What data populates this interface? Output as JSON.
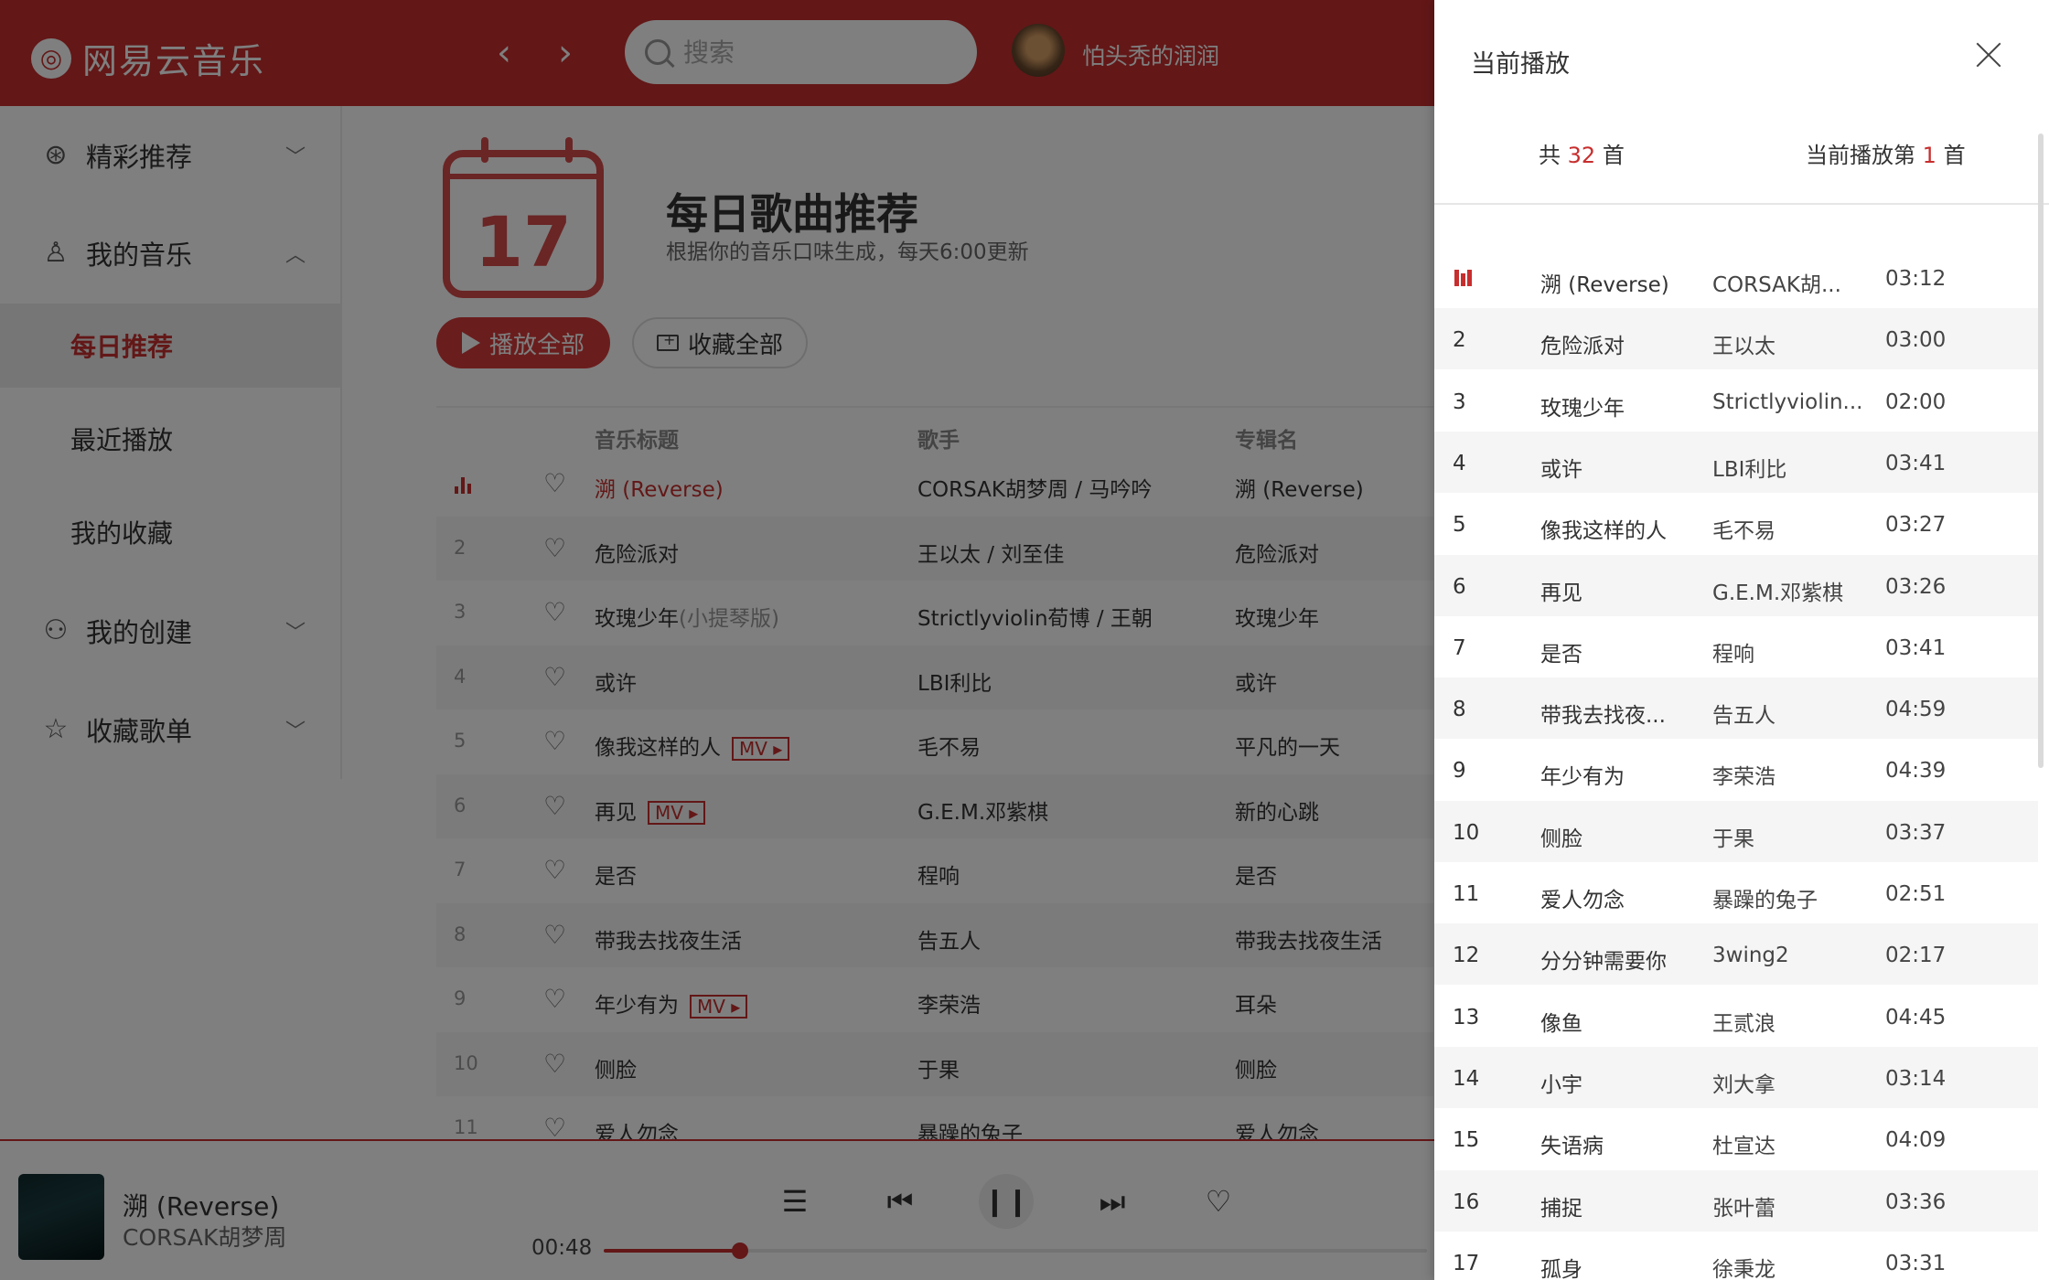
{
  "header": {
    "app_name": "网易云音乐",
    "back_icon": "‹",
    "forward_icon": "›",
    "search_placeholder": "搜索",
    "username": "怕头秃的润润"
  },
  "sidebar": {
    "groups": [
      {
        "label": "精彩推荐",
        "icon": "basketball-icon",
        "expanded": false
      },
      {
        "label": "我的音乐",
        "icon": "user-icon",
        "expanded": true
      },
      {
        "label": "我的创建",
        "icon": "bicycle-icon",
        "expanded": false
      },
      {
        "label": "收藏歌单",
        "icon": "star-icon",
        "expanded": false
      }
    ],
    "sub_items": [
      "每日推荐",
      "最近播放",
      "我的收藏"
    ],
    "active_item": "每日推荐"
  },
  "main": {
    "calendar_day": "17",
    "title": "每日歌曲推荐",
    "subtitle": "根据你的音乐口味生成，每天6:00更新",
    "play_all": "播放全部",
    "collect_all": "收藏全部",
    "columns": [
      "音乐标题",
      "歌手",
      "专辑名"
    ],
    "songs": [
      {
        "index": "1",
        "title": "溯 (Reverse)",
        "title_extra": "",
        "mv": false,
        "artist": "CORSAK胡梦周 / 马吟吟",
        "album": "溯 (Reverse)",
        "playing": true
      },
      {
        "index": "2",
        "title": "危险派对",
        "title_extra": "",
        "mv": false,
        "artist": "王以太 / 刘至佳",
        "album": "危险派对",
        "playing": false
      },
      {
        "index": "3",
        "title": "玫瑰少年",
        "title_extra": "(小提琴版)",
        "mv": false,
        "artist": "Strictlyviolin荀博 / 王朝",
        "album": "玫瑰少年",
        "playing": false
      },
      {
        "index": "4",
        "title": "或许",
        "title_extra": "",
        "mv": false,
        "artist": "LBI利比",
        "album": "或许",
        "playing": false
      },
      {
        "index": "5",
        "title": "像我这样的人",
        "title_extra": "",
        "mv": true,
        "artist": "毛不易",
        "album": "平凡的一天",
        "playing": false
      },
      {
        "index": "6",
        "title": "再见",
        "title_extra": "",
        "mv": true,
        "artist": "G.E.M.邓紫棋",
        "album": "新的心跳",
        "playing": false
      },
      {
        "index": "7",
        "title": "是否",
        "title_extra": "",
        "mv": false,
        "artist": "程响",
        "album": "是否",
        "playing": false
      },
      {
        "index": "8",
        "title": "带我去找夜生活",
        "title_extra": "",
        "mv": false,
        "artist": "告五人",
        "album": "带我去找夜生活",
        "playing": false
      },
      {
        "index": "9",
        "title": "年少有为",
        "title_extra": "",
        "mv": true,
        "artist": "李荣浩",
        "album": "耳朵",
        "playing": false
      },
      {
        "index": "10",
        "title": "侧脸",
        "title_extra": "",
        "mv": false,
        "artist": "于果",
        "album": "侧脸",
        "playing": false
      },
      {
        "index": "11",
        "title": "爱人勿念",
        "title_extra": "",
        "mv": false,
        "artist": "暴躁的兔子",
        "album": "爱人勿念",
        "playing": false
      }
    ],
    "mv_label": "MV ▸"
  },
  "player": {
    "song": "溯 (Reverse)",
    "artist": "CORSAK胡梦周",
    "current_time": "00:48",
    "progress_fraction": 0.165,
    "playlist_icon": "☰",
    "prev_icon": "⏮",
    "pause_icon": "❙❙",
    "next_icon": "⏭",
    "like_icon": "♡"
  },
  "panel": {
    "title": "当前播放",
    "total_prefix": "共",
    "total_count": "32",
    "total_suffix": "首",
    "current_prefix": "当前播放第",
    "current_index": "1",
    "current_suffix": "首",
    "tracks": [
      {
        "index": "1",
        "title": "溯 (Reverse)",
        "artist": "CORSAK胡...",
        "duration": "03:12",
        "playing": true
      },
      {
        "index": "2",
        "title": "危险派对",
        "artist": "王以太",
        "duration": "03:00",
        "playing": false
      },
      {
        "index": "3",
        "title": "玫瑰少年",
        "artist": "Strictlyviolin...",
        "duration": "02:00",
        "playing": false
      },
      {
        "index": "4",
        "title": "或许",
        "artist": "LBI利比",
        "duration": "03:41",
        "playing": false
      },
      {
        "index": "5",
        "title": "像我这样的人",
        "artist": "毛不易",
        "duration": "03:27",
        "playing": false
      },
      {
        "index": "6",
        "title": "再见",
        "artist": "G.E.M.邓紫棋",
        "duration": "03:26",
        "playing": false
      },
      {
        "index": "7",
        "title": "是否",
        "artist": "程响",
        "duration": "03:41",
        "playing": false
      },
      {
        "index": "8",
        "title": "带我去找夜...",
        "artist": "告五人",
        "duration": "04:59",
        "playing": false
      },
      {
        "index": "9",
        "title": "年少有为",
        "artist": "李荣浩",
        "duration": "04:39",
        "playing": false
      },
      {
        "index": "10",
        "title": "侧脸",
        "artist": "于果",
        "duration": "03:37",
        "playing": false
      },
      {
        "index": "11",
        "title": "爱人勿念",
        "artist": "暴躁的兔子",
        "duration": "02:51",
        "playing": false
      },
      {
        "index": "12",
        "title": "分分钟需要你",
        "artist": "3wing2",
        "duration": "02:17",
        "playing": false
      },
      {
        "index": "13",
        "title": "像鱼",
        "artist": "王贰浪",
        "duration": "04:45",
        "playing": false
      },
      {
        "index": "14",
        "title": "小宇",
        "artist": "刘大拿",
        "duration": "03:14",
        "playing": false
      },
      {
        "index": "15",
        "title": "失语病",
        "artist": "杜宣达",
        "duration": "04:09",
        "playing": false
      },
      {
        "index": "16",
        "title": "捕捉",
        "artist": "张叶蕾",
        "duration": "03:36",
        "playing": false
      },
      {
        "index": "17",
        "title": "孤身",
        "artist": "徐秉龙",
        "duration": "03:31",
        "playing": false
      }
    ]
  },
  "colors": {
    "brand": "#c72e2e",
    "overlay": "rgba(0,0,0,0.5)"
  }
}
